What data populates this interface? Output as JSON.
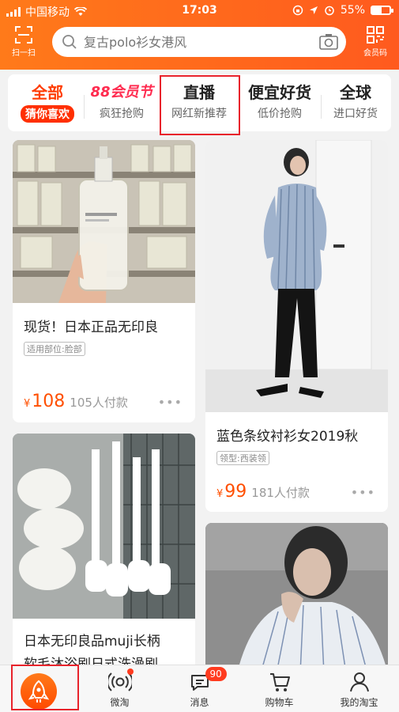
{
  "status_bar": {
    "carrier": "中国移动",
    "time": "17:03",
    "battery": "55%",
    "battery_level": 0.55
  },
  "header": {
    "scan_label": "扫一扫",
    "search_placeholder": "复古polo衫女港风",
    "member_code_label": "会员码"
  },
  "category_tabs": [
    {
      "title": "全部",
      "subtitle": "猜你喜欢",
      "active": true
    },
    {
      "title": "88会员节",
      "subtitle": "疯狂抢购"
    },
    {
      "title": "直播",
      "subtitle": "网红新推荐",
      "highlighted": true
    },
    {
      "title": "便宜好货",
      "subtitle": "低价抢购"
    },
    {
      "title": "全球",
      "subtitle": "进口好货"
    }
  ],
  "feed": {
    "left": [
      {
        "title": "现货！日本正品无印良",
        "tag": "适用部位:脸部",
        "currency": "¥",
        "price": "108",
        "sold": "105人付款"
      },
      {
        "title": "日本无印良品muji长柄",
        "title_line2": "软毛沐浴刷日式洗澡刷"
      }
    ],
    "right": [
      {
        "title": "蓝色条纹衬衫女2019秋",
        "tag": "领型:西装领",
        "currency": "¥",
        "price": "99",
        "sold": "181人付款"
      },
      {
        "title": ""
      }
    ]
  },
  "tabbar": {
    "home_label": "",
    "weitao_label": "微淘",
    "messages_label": "消息",
    "messages_badge": "90",
    "cart_label": "购物车",
    "mytaobao_label": "我的淘宝"
  },
  "colors": {
    "brand_orange": "#ff5a1e",
    "price_orange": "#ff4f00",
    "highlight_red": "#e8232b"
  }
}
